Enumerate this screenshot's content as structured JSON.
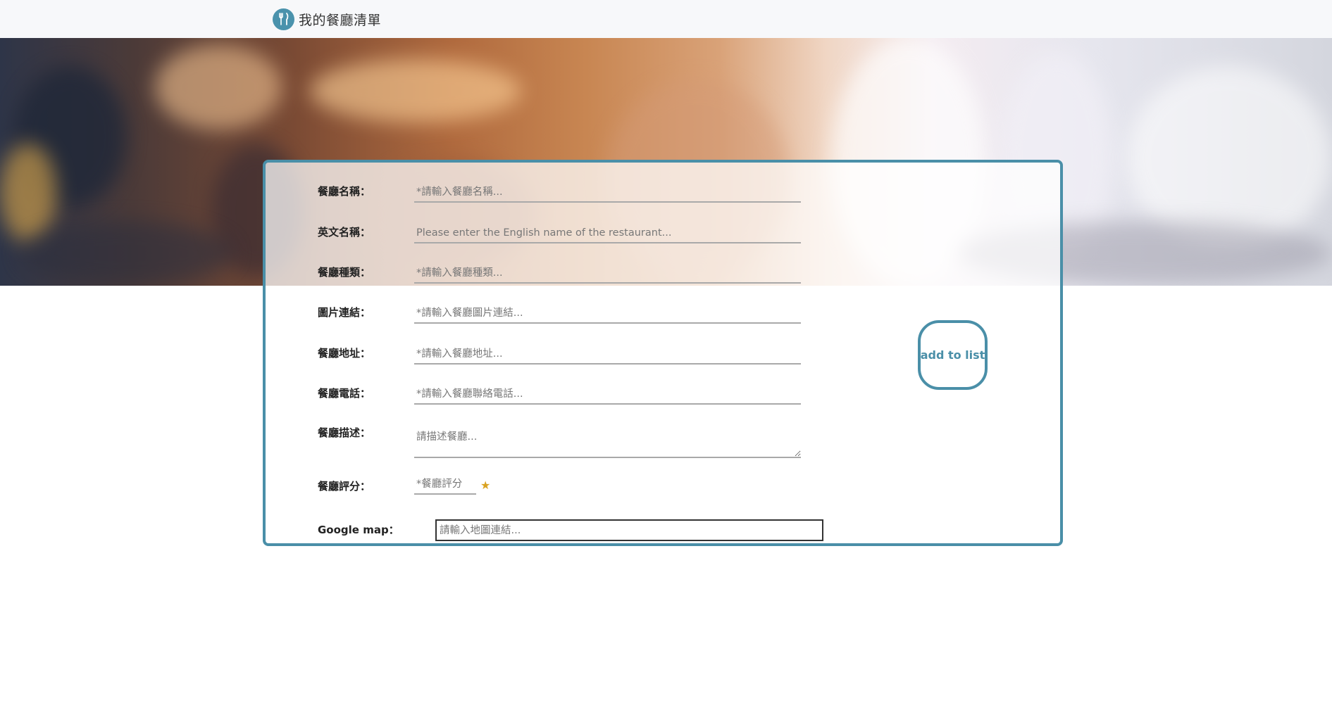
{
  "navbar": {
    "brand_title": "我的餐廳清單",
    "brand_icon": "utensils-icon"
  },
  "colors": {
    "accent": "#4a8fa8",
    "star": "#d9a221",
    "navbar_bg": "#f7f8fa"
  },
  "form": {
    "name": {
      "label": "餐廳名稱：",
      "placeholder": "*請輸入餐廳名稱..."
    },
    "name_en": {
      "label": "英文名稱：",
      "placeholder": "Please enter the English name of the restaurant..."
    },
    "category": {
      "label": "餐廳種類：",
      "placeholder": "*請輸入餐廳種類..."
    },
    "image": {
      "label": "圖片連結：",
      "placeholder": "*請輸入餐廳圖片連結..."
    },
    "location": {
      "label": "餐廳地址：",
      "placeholder": "*請輸入餐廳地址..."
    },
    "phone": {
      "label": "餐廳電話：",
      "placeholder": "*請輸入餐廳聯絡電話..."
    },
    "description": {
      "label": "餐廳描述：",
      "placeholder": "請描述餐廳..."
    },
    "rating": {
      "label": "餐廳評分：",
      "placeholder": "*餐廳評分",
      "icon": "star-icon"
    },
    "google_map": {
      "label": "Google map：",
      "placeholder": "請輸入地圖連結..."
    },
    "submit_label": "add to list"
  }
}
